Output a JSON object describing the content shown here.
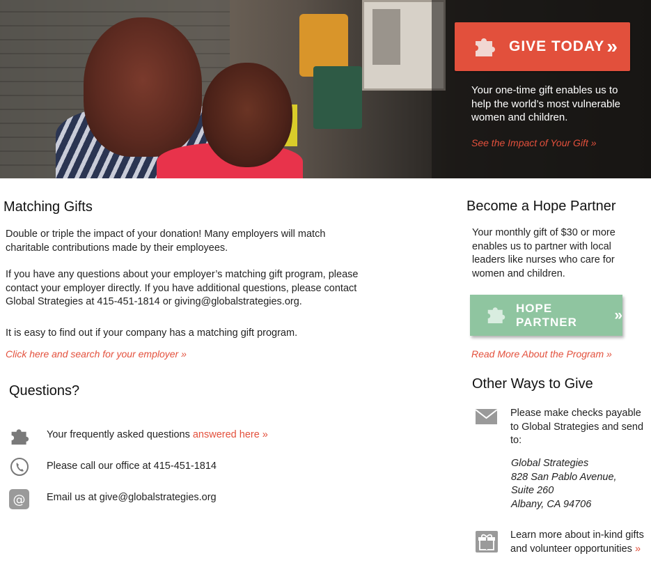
{
  "hero": {
    "give_button_label": "GIVE TODAY",
    "give_button_chevron": "»",
    "description": "Your one-time gift enables us to help the world’s most vulnerable women and children.",
    "impact_link": "See the Impact of Your Gift »"
  },
  "matching": {
    "title": "Matching Gifts",
    "para1": "Double or triple the impact of your donation! Many employers will match charitable contributions made by their employees.",
    "para2": "If you have any questions about your employer’s matching gift program, please contact your employer directly. If you have additional questions, please contact Global Strategies at 415-451-1814 or giving@globalstrategies.org.",
    "para3": "It is easy to  find out if your company has a matching gift program.",
    "search_link": "Click here and search for your employer »"
  },
  "questions": {
    "title": "Questions?",
    "faq_text": "Your frequently asked questions ",
    "faq_link": "answered here »",
    "call_text": "Please call our office at 415-451-1814",
    "email_text": "Email us at give@globalstrategies.org",
    "icons": [
      "puzzle-icon",
      "phone-icon",
      "at-icon"
    ]
  },
  "hope": {
    "title": "Become a Hope Partner",
    "description": "Your monthly gift of $30 or more enables us to partner with local leaders like nurses who care for women and children.",
    "button_label": "HOPE PARTNER",
    "button_chevron": "»",
    "read_more_link": "Read More About the Program »"
  },
  "other": {
    "title": "Other Ways to Give",
    "checks_text": "Please make checks payable to Global Strategies and send to:",
    "address": [
      "Global Strategies",
      "828 San Pablo Avenue,",
      "Suite 260",
      "Albany, CA 94706"
    ],
    "inkind_text": "Learn more about in-kind gifts and volunteer opportunities ",
    "inkind_link": "»"
  },
  "colors": {
    "accent": "#e3503c",
    "give_button": "#e2503c",
    "hope_button": "#8fc5a0"
  }
}
